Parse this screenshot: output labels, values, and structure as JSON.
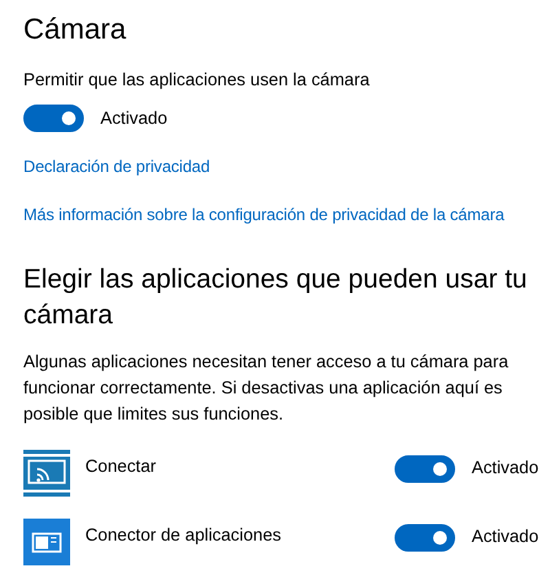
{
  "title": "Cámara",
  "permission": {
    "label": "Permitir que las aplicaciones usen la cámara",
    "on": true,
    "state_text": "Activado"
  },
  "links": [
    "Declaración de privacidad",
    "Más información sobre la configuración de privacidad de la cámara"
  ],
  "apps_section": {
    "heading": "Elegir las aplicaciones que pueden usar tu cámara",
    "description": "Algunas aplicaciones necesitan tener acceso a tu cámara para funcionar correctamente. Si desactivas una aplicación aquí es posible que limites sus funciones.",
    "apps": [
      {
        "name": "Conectar",
        "kind": "connect",
        "on": true,
        "state_text": "Activado"
      },
      {
        "name": "Conector de aplicaciones",
        "kind": "connector",
        "on": true,
        "state_text": "Activado"
      }
    ]
  }
}
